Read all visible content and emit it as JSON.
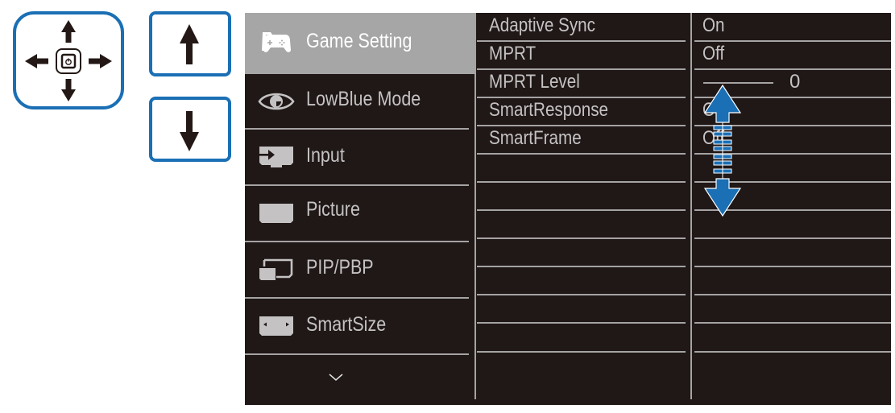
{
  "keys": {
    "dpad": {
      "icon": "dpad-icon",
      "center_icon": "power-icon",
      "directions": [
        "up",
        "down",
        "left",
        "right"
      ]
    },
    "up": {
      "icon": "arrow-up-icon"
    },
    "down": {
      "icon": "arrow-down-icon"
    },
    "border_color": "#1a6fb5"
  },
  "osd": {
    "main_menu": [
      {
        "label": "Game Setting",
        "icon": "gamepad-icon",
        "active": true
      },
      {
        "label": "LowBlue Mode",
        "icon": "eye-icon",
        "active": false
      },
      {
        "label": "Input",
        "icon": "input-icon",
        "active": false
      },
      {
        "label": "Picture",
        "icon": "picture-icon",
        "active": false
      },
      {
        "label": "PIP/PBP",
        "icon": "pip-icon",
        "active": false
      },
      {
        "label": "SmartSize",
        "icon": "smartsize-icon",
        "active": false
      }
    ],
    "more_icon": "chevron-down-icon",
    "submenu": [
      {
        "label": "Adaptive Sync",
        "value": "On"
      },
      {
        "label": "MPRT",
        "value": "Off"
      },
      {
        "label": "MPRT Level",
        "value": "0",
        "type": "slider",
        "slider_level": 0
      },
      {
        "label": "SmartResponse",
        "value": "Off"
      },
      {
        "label": "SmartFrame",
        "value": "Off"
      }
    ],
    "empty_rows": 7,
    "scroll_indicator": "scroll-updown-icon",
    "colors": {
      "panel_bg": "#201717",
      "highlight_bg": "#a6a6a6",
      "text": "#c4c2c2",
      "divider": "#a5a3a3",
      "accent": "#1a6fb5"
    }
  }
}
